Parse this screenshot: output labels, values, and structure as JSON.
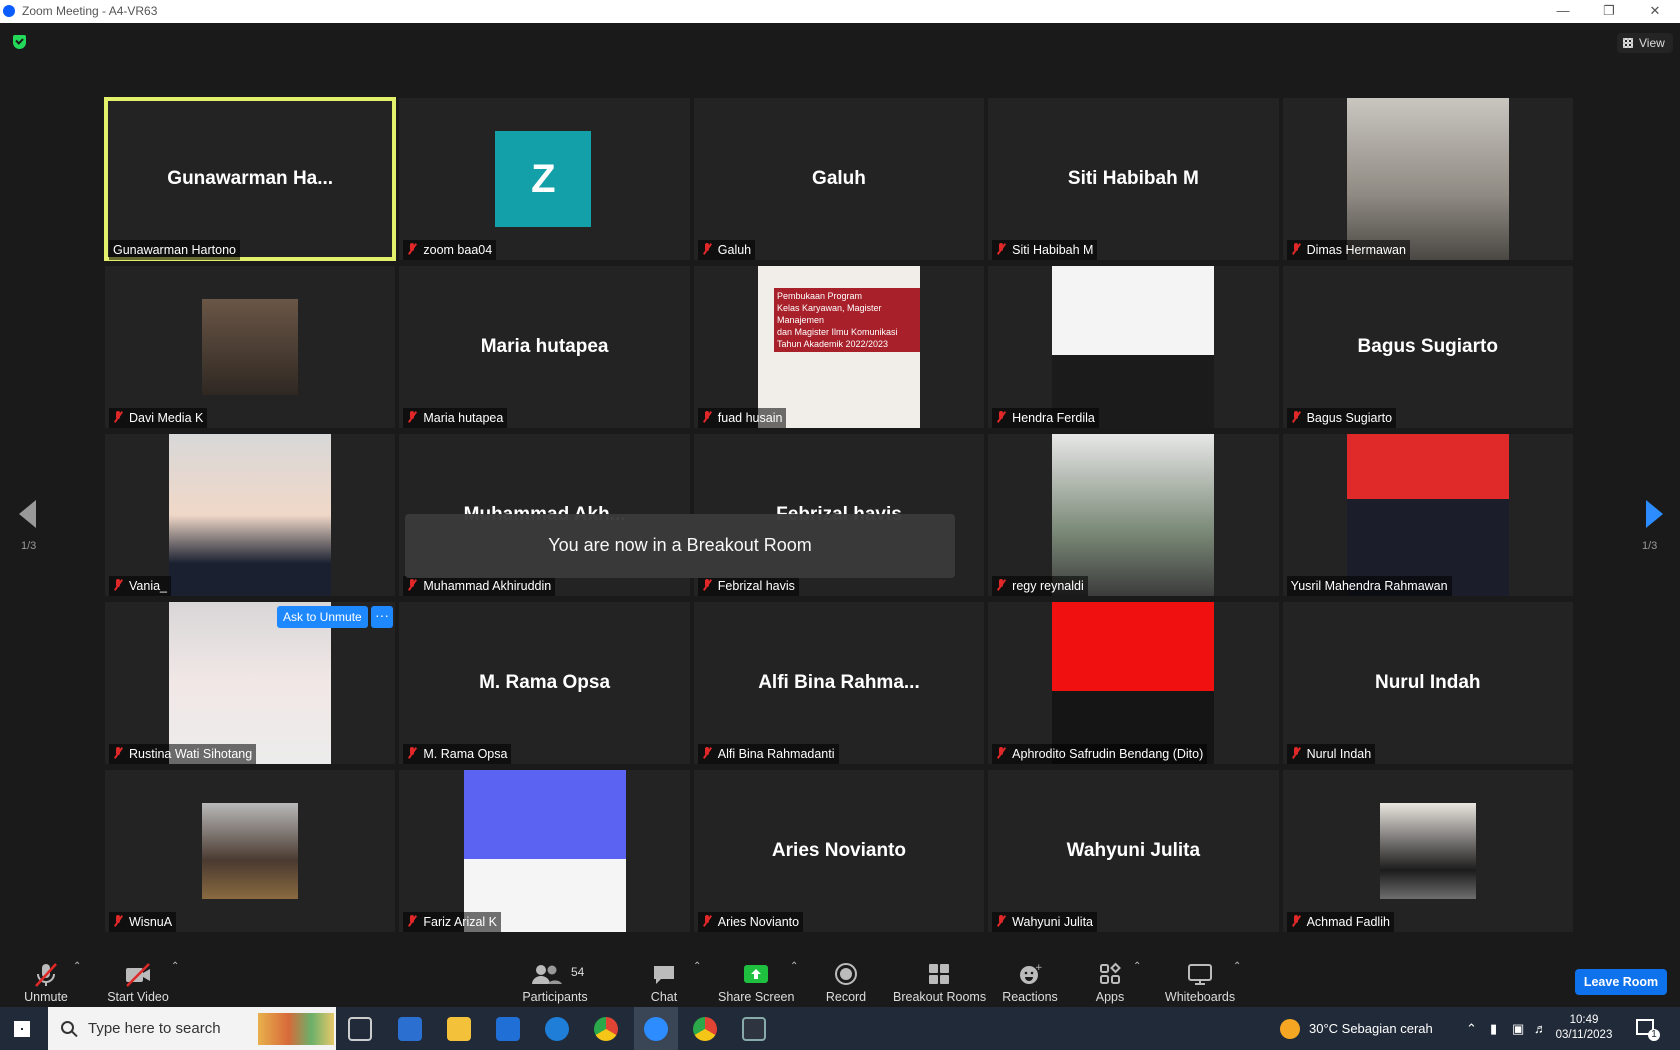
{
  "window": {
    "title": "Zoom Meeting - A4-VR63"
  },
  "topbar": {
    "view_label": "View"
  },
  "pager": {
    "left": "1/3",
    "right": "1/3"
  },
  "tiles": [
    {
      "display": "Gunawarman  Ha...",
      "label": "Gunawarman Hartono",
      "muted": false
    },
    {
      "display": "Z",
      "label": "zoom baa04",
      "muted": true
    },
    {
      "display": "Galuh",
      "label": "Galuh",
      "muted": true
    },
    {
      "display": "Siti Habibah M",
      "label": "Siti Habibah M",
      "muted": true
    },
    {
      "display": "",
      "label": "Dimas Hermawan",
      "muted": true
    },
    {
      "display": "",
      "label": "Davi Media K",
      "muted": true
    },
    {
      "display": "Maria hutapea",
      "label": "Maria hutapea",
      "muted": true
    },
    {
      "display": "",
      "label": "fuad husain",
      "muted": true,
      "slide_text": "Pembukaan Program\nKelas Karyawan, Magister Manajemen\ndan Magister Ilmu Komunikasi\nTahun Akademik 2022/2023"
    },
    {
      "display": "",
      "label": "Hendra Ferdila",
      "muted": true
    },
    {
      "display": "Bagus Sugiarto",
      "label": "Bagus Sugiarto",
      "muted": true
    },
    {
      "display": "",
      "label": "Vania_",
      "muted": true
    },
    {
      "display": "Muhammad  Akh...",
      "label": "Muhammad Akhiruddin",
      "muted": true
    },
    {
      "display": "Febrizal havis",
      "label": "Febrizal havis",
      "muted": true
    },
    {
      "display": "",
      "label": "regy reynaldi",
      "muted": true
    },
    {
      "display": "",
      "label": "Yusril Mahendra Rahmawan",
      "muted": false
    },
    {
      "display": "",
      "label": "Rustina Wati Sihotang",
      "muted": true
    },
    {
      "display": "M. Rama Opsa",
      "label": "M. Rama Opsa",
      "muted": true
    },
    {
      "display": "Alfi Bina  Rahma...",
      "label": "Alfi Bina Rahmadanti",
      "muted": true
    },
    {
      "display": "",
      "label": "Aphrodito Safrudin Bendang (Dito)",
      "muted": true
    },
    {
      "display": "Nurul Indah",
      "label": "Nurul Indah",
      "muted": true
    },
    {
      "display": "",
      "label": "WisnuA",
      "muted": true
    },
    {
      "display": "",
      "label": "Fariz Arizal K",
      "muted": true
    },
    {
      "display": "Aries Novianto",
      "label": "Aries Novianto",
      "muted": true
    },
    {
      "display": "Wahyuni Julita",
      "label": "Wahyuni Julita",
      "muted": true
    },
    {
      "display": "",
      "label": "Achmad Fadlih",
      "muted": true
    }
  ],
  "banner": {
    "text": "You are now in a Breakout Room"
  },
  "hover_actions": {
    "ask_to_unmute": "Ask to Unmute",
    "more": "···"
  },
  "toolbar": {
    "unmute": "Unmute",
    "start_video": "Start Video",
    "participants": "Participants",
    "participants_count": "54",
    "chat": "Chat",
    "share_screen": "Share Screen",
    "record": "Record",
    "breakout_rooms": "Breakout Rooms",
    "reactions": "Reactions",
    "apps": "Apps",
    "whiteboards": "Whiteboards",
    "leave_room": "Leave Room"
  },
  "taskbar": {
    "search_placeholder": "Type here to search",
    "weather": "30°C  Sebagian cerah",
    "time": "10:49",
    "date": "03/11/2023",
    "notification_count": "1"
  },
  "colors": {
    "accent": "#0e72ed",
    "share_green": "#1fbf3f",
    "active_speaker": "#e2f06b",
    "mute_red": "#e02828"
  }
}
